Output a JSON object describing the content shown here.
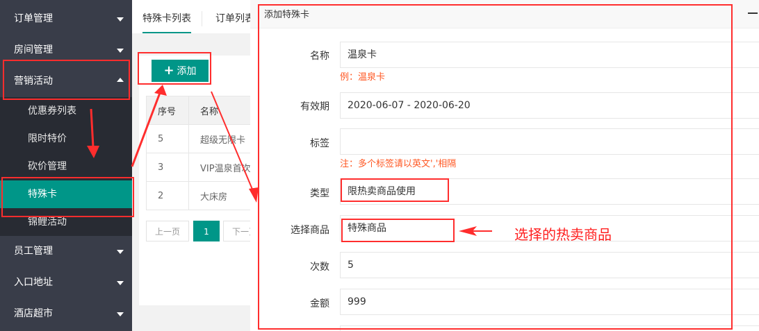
{
  "sidebar": {
    "menus": [
      {
        "label": "订单管理"
      },
      {
        "label": "房间管理"
      },
      {
        "label": "营销活动"
      },
      {
        "label": "员工管理"
      },
      {
        "label": "入口地址"
      },
      {
        "label": "酒店超市"
      }
    ],
    "submenu": [
      {
        "label": "优惠券列表"
      },
      {
        "label": "限时特价"
      },
      {
        "label": "砍价管理"
      },
      {
        "label": "特殊卡"
      },
      {
        "label": "锦鲤活动"
      }
    ]
  },
  "tabs": {
    "tab1": "特殊卡列表",
    "tab2": "订单列表"
  },
  "toolbar": {
    "add_label": "添加",
    "add_icon": "plus-icon"
  },
  "table": {
    "headers": [
      "序号",
      "名称"
    ],
    "rows": [
      [
        "5",
        "超级无限卡"
      ],
      [
        "3",
        "VIP温泉首次"
      ],
      [
        "2",
        "大床房"
      ]
    ]
  },
  "pager": {
    "prev": "上一页",
    "current": "1",
    "next": "下一页"
  },
  "modal": {
    "title": "添加特殊卡",
    "name_label": "名称",
    "name_value": "温泉卡",
    "name_tip": "例：温泉卡",
    "validity_label": "有效期",
    "validity_value": "2020-06-07 - 2020-06-20",
    "tags_label": "标签",
    "tags_value": "",
    "tags_tip": "注：多个标签请以英文','相隔",
    "type_label": "类型",
    "type_value": "限热卖商品使用",
    "goods_label": "选择商品",
    "goods_value": "特殊商品",
    "count_label": "次数",
    "count_value": "5",
    "amount_label": "金额",
    "amount_value": "999"
  },
  "annotation": {
    "text": "选择的热卖商品",
    "color": "#ff1f1f"
  },
  "colors": {
    "accent": "#009688",
    "sidebar": "#393d49",
    "tip": "#ff5722"
  }
}
